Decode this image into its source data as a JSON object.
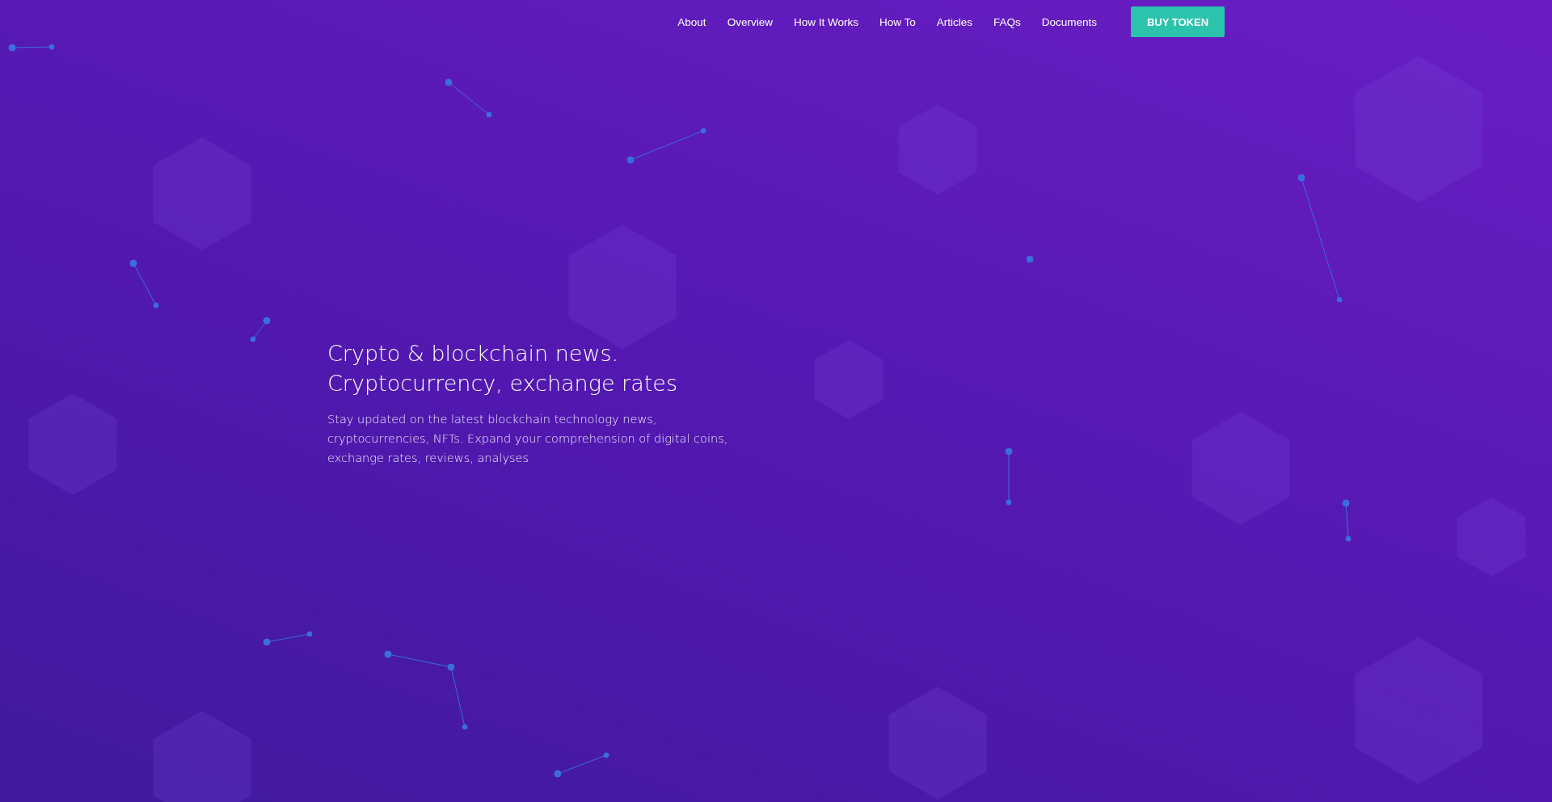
{
  "nav": {
    "links": [
      {
        "label": "About"
      },
      {
        "label": "Overview"
      },
      {
        "label": "How It Works"
      },
      {
        "label": "How To"
      },
      {
        "label": "Articles"
      },
      {
        "label": "FAQs"
      },
      {
        "label": "Documents"
      }
    ],
    "cta": "BUY TOKEN"
  },
  "hero": {
    "title_lines": [
      "Crypto & blockchain news.",
      "Cryptocurrency, exchange rates"
    ],
    "description": "Stay updated on the latest blockchain technology news, cryptocurrencies, NFTs. Expand your comprehension of digital coins, exchange rates, reviews, analyses"
  }
}
